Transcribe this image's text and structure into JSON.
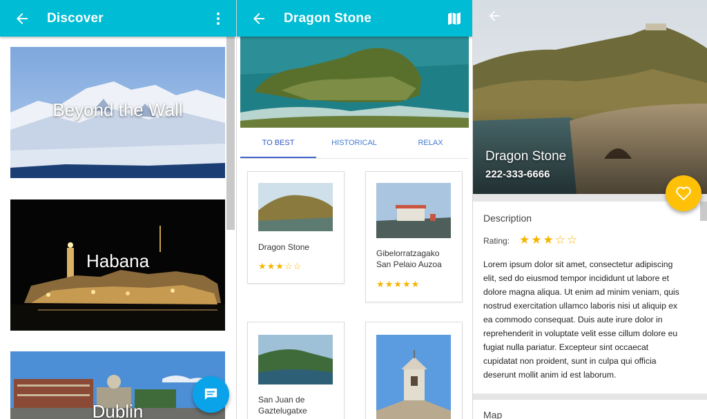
{
  "discover": {
    "title": "Discover",
    "cards": [
      {
        "label": "Beyond the Wall"
      },
      {
        "label": "Habana"
      },
      {
        "label": "Dublin"
      }
    ]
  },
  "detail": {
    "title": "Dragon Stone",
    "tabs": [
      {
        "label": "TO BEST"
      },
      {
        "label": "HISTORICAL"
      },
      {
        "label": "RELAX"
      }
    ],
    "places": [
      {
        "name": "Dragon Stone",
        "rating": 3,
        "stars": "★★★☆☆"
      },
      {
        "name": "Gibelorratzagako San Pelaio Auzoa",
        "line1": "Gibelorratzagako",
        "line2": "San Pelaio Auzoa",
        "rating": 5,
        "stars": "★★★★★"
      },
      {
        "name": "San Juan de Gaztelugatxe",
        "line1": "San Juan de",
        "line2": "Gaztelugatxe"
      },
      {
        "name": ""
      }
    ]
  },
  "info": {
    "name": "Dragon Stone",
    "phone": "222-333-6666",
    "description_label": "Description",
    "rating_label": "Rating:",
    "rating": 3,
    "rating_stars": "★★★☆☆",
    "description": [
      "Lorem ipsum dolor sit amet, consectetur adipiscing",
      "elit, sed do eiusmod tempor incididunt ut labore et",
      "dolore magna aliqua. Ut enim ad minim veniam, quis",
      "nostrud exercitation ullamco laboris nisi ut aliquip ex",
      "ea commodo consequat. Duis aute irure dolor in",
      "reprehenderit in voluptate velit esse cillum dolore eu",
      "fugiat nulla pariatur. Excepteur sint occaecat",
      "cupidatat non proident, sunt in culpa qui officia",
      "deserunt mollit anim id est laborum."
    ],
    "map_label": "Map"
  },
  "colors": {
    "appbar": "#00bcd4",
    "fab": "#0aa2e8",
    "favorite": "#ffc107",
    "star": "#f6b400",
    "tab": "#3f62c9"
  },
  "icons": [
    "back-arrow-icon",
    "more-vert-icon",
    "map-icon",
    "chat-icon",
    "heart-icon",
    "star-icon"
  ]
}
